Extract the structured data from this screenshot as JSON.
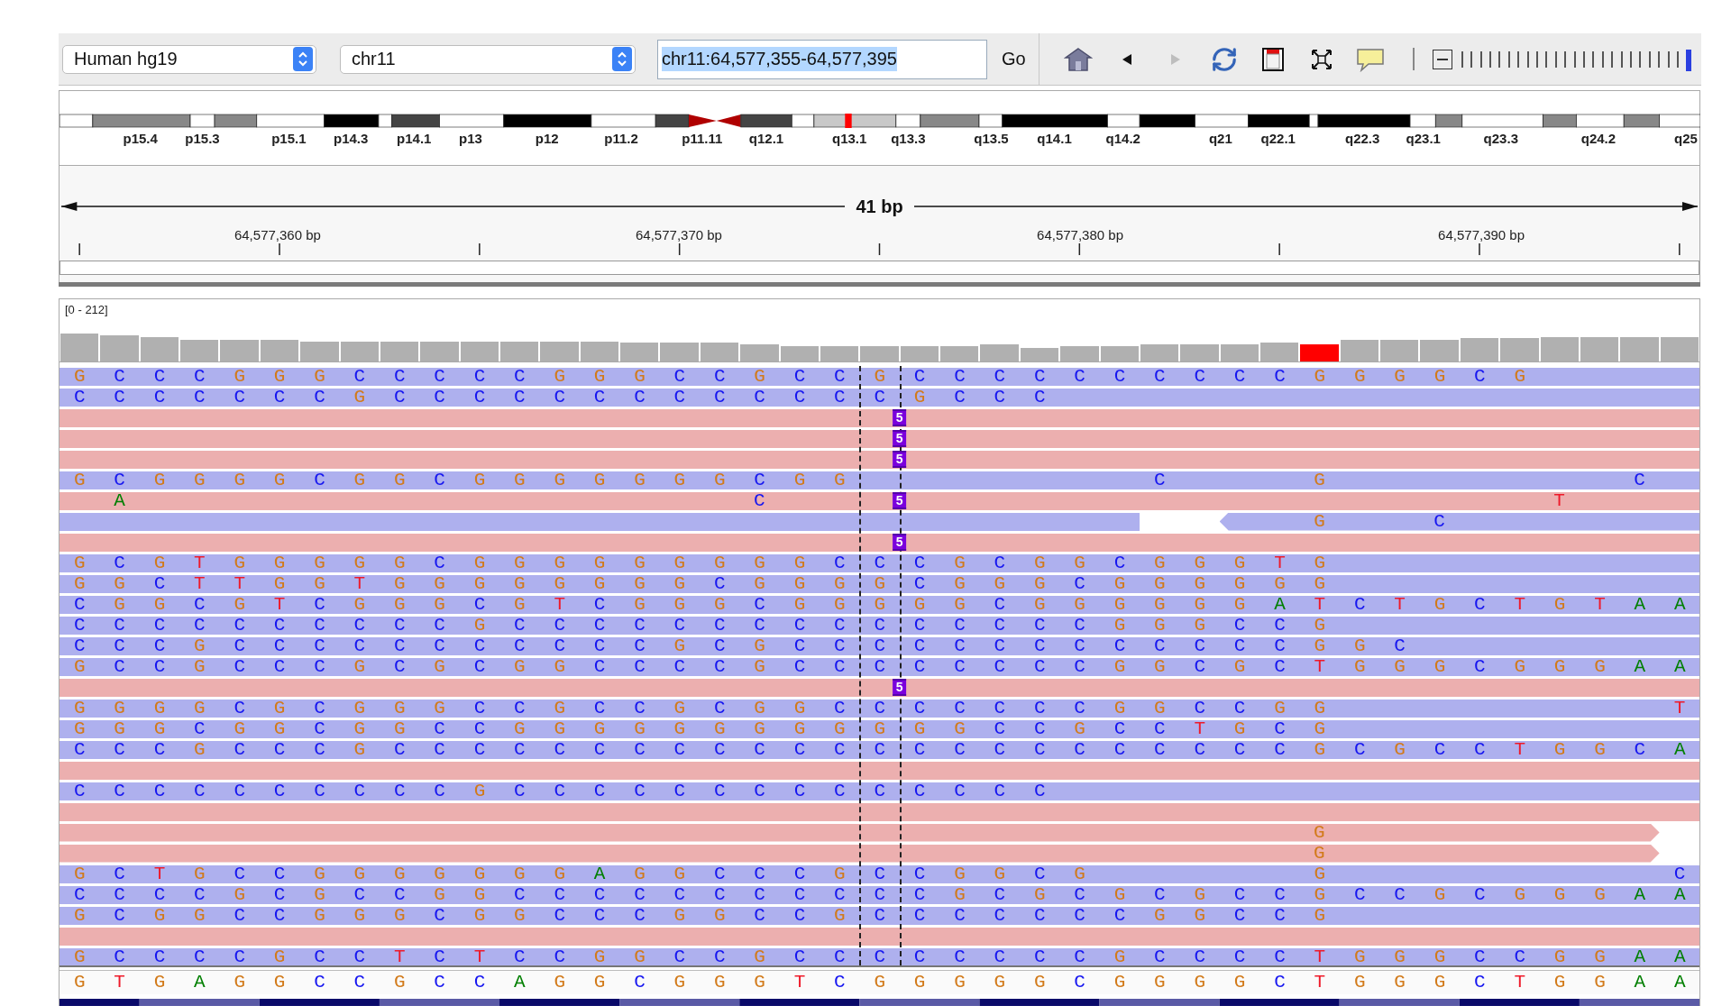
{
  "toolbar": {
    "genome": "Human hg19",
    "chromosome": "chr11",
    "locus": {
      "value": "chr11:64,577,355-64,577,395",
      "selected": true
    },
    "go": "Go",
    "tools": [
      {
        "kind": "home",
        "disabled": false
      },
      {
        "kind": "back",
        "disabled": false
      },
      {
        "kind": "forward",
        "disabled": true
      },
      {
        "kind": "refresh",
        "disabled": false
      },
      {
        "kind": "region",
        "disabled": false
      },
      {
        "kind": "fit",
        "disabled": false
      },
      {
        "kind": "popup",
        "disabled": false
      }
    ],
    "zoom": {
      "level": 1
    }
  },
  "ideogram": {
    "bands": [
      {
        "kind": "gneg"
      },
      {
        "kind": "gpos50"
      },
      {
        "kind": "gneg"
      },
      {
        "kind": "gpos50"
      },
      {
        "kind": "gneg"
      },
      {
        "kind": "gpos100"
      },
      {
        "kind": "gneg"
      },
      {
        "kind": "gpos75"
      },
      {
        "kind": "gneg"
      },
      {
        "kind": "gpos100"
      },
      {
        "kind": "gneg"
      },
      {
        "kind": "gpos75"
      },
      {
        "kind": "acen"
      },
      {
        "kind": "acen"
      },
      {
        "kind": "gpos75"
      },
      {
        "kind": "gneg"
      },
      {
        "kind": "gpos25"
      },
      {
        "kind": "gneg"
      },
      {
        "kind": "gpos50"
      },
      {
        "kind": "gneg"
      },
      {
        "kind": "gpos100"
      },
      {
        "kind": "gneg"
      },
      {
        "kind": "gpos100"
      },
      {
        "kind": "gneg"
      },
      {
        "kind": "gpos100"
      },
      {
        "kind": "gneg"
      },
      {
        "kind": "gpos100"
      },
      {
        "kind": "gneg"
      },
      {
        "kind": "gpos50"
      },
      {
        "kind": "gneg"
      },
      {
        "kind": "gpos50"
      },
      {
        "kind": "gneg"
      },
      {
        "kind": "gpos50"
      },
      {
        "kind": "gneg"
      }
    ],
    "labels": [
      "p15.4",
      "p15.3",
      "p15.1",
      "p14.3",
      "p14.1",
      "p13",
      "p12",
      "p11.2",
      "p11.11",
      "q12.1",
      "q13.1",
      "q13.3",
      "q13.5",
      "q14.1",
      "q14.2",
      "q21",
      "q22.1",
      "q22.3",
      "q23.1",
      "q23.3",
      "q24.2",
      "q25"
    ]
  },
  "ruler": {
    "span": "41 bp",
    "ticks": [
      "64,577,360 bp",
      "64,577,370 bp",
      "64,577,380 bp",
      "64,577,390 bp"
    ]
  },
  "coverage": {
    "range": "[0 - 212]",
    "bars": [
      {
        "mismatch": false
      },
      {
        "mismatch": false
      },
      {
        "mismatch": false
      },
      {
        "mismatch": false
      },
      {
        "mismatch": false
      },
      {
        "mismatch": false
      },
      {
        "mismatch": false
      },
      {
        "mismatch": false
      },
      {
        "mismatch": false
      },
      {
        "mismatch": false
      },
      {
        "mismatch": false
      },
      {
        "mismatch": false
      },
      {
        "mismatch": false
      },
      {
        "mismatch": false
      },
      {
        "mismatch": false
      },
      {
        "mismatch": false
      },
      {
        "mismatch": false
      },
      {
        "mismatch": false
      },
      {
        "mismatch": false
      },
      {
        "mismatch": false
      },
      {
        "mismatch": false
      },
      {
        "mismatch": false
      },
      {
        "mismatch": false
      },
      {
        "mismatch": false
      },
      {
        "mismatch": false
      },
      {
        "mismatch": false
      },
      {
        "mismatch": false
      },
      {
        "mismatch": false
      },
      {
        "mismatch": false
      },
      {
        "mismatch": false
      },
      {
        "mismatch": false
      },
      {
        "mismatch": true
      },
      {
        "mismatch": false
      },
      {
        "mismatch": false
      },
      {
        "mismatch": false
      },
      {
        "mismatch": false
      },
      {
        "mismatch": false
      },
      {
        "mismatch": false
      },
      {
        "mismatch": false
      },
      {
        "mismatch": false
      },
      {
        "mismatch": false
      }
    ]
  },
  "reads": [
    {
      "kind": "reverse",
      "bases": [
        "G C C C G G G C C C C C G G G C C G C C G C C C C C C C C C C G G G G C G"
      ]
    },
    {
      "kind": "reverse",
      "bases": [
        "C C C C C C C G C C C C C C C C C C C C C G C C C"
      ]
    },
    {
      "kind": "forward",
      "insertion": "5"
    },
    {
      "kind": "forward",
      "insertion": "5"
    },
    {
      "kind": "forward",
      "insertion": "5"
    },
    {
      "kind": "reverse",
      "bases": [
        "G C G G G G C G G C G G G G G G G C G G",
        "               C",
        "       G",
        "               C"
      ]
    },
    {
      "kind": "forward",
      "insertion": "5",
      "bases": [
        "  A",
        "                               C",
        "                                       T"
      ]
    },
    {
      "kind": "reverse_split",
      "bases": [
        "                                                              G",
        "     C"
      ]
    },
    {
      "kind": "forward",
      "insertion": "5"
    },
    {
      "kind": "reverse",
      "bases": [
        "G C G T G G G G G C G G G G G G G G G C C C G C G G C G G G T G"
      ]
    },
    {
      "kind": "reverse",
      "bases": [
        "G G C T T G G T G G G G G G G G C G G G G C G G G C G G G G G G"
      ]
    },
    {
      "kind": "reverse",
      "bases": [
        "C G G C G T C G G G C G T C G G G C G G G G G C G G G G G G A T C T G C T G T A A"
      ]
    },
    {
      "kind": "reverse",
      "bases": [
        "C C C C C C C C C C G C C C C C C C C C C C C C C C G G G C C G"
      ]
    },
    {
      "kind": "reverse",
      "bases": [
        "C C C G C C C C C C C C C C C G C G C C C C C C C C C C C C C G G C"
      ]
    },
    {
      "kind": "reverse",
      "bases": [
        "G C C G C C C G C G C G G C C C C G C C C C C C C C G G C G C T G G G C G G G A A"
      ]
    },
    {
      "kind": "forward",
      "insertion": "5"
    },
    {
      "kind": "reverse",
      "bases": [
        "G G G G C G C G G G C C G C C G C G G C C C C C C C G G C C G G",
        "                 T"
      ]
    },
    {
      "kind": "reverse",
      "bases": [
        "G G G C G G C G G C C G G G G G G G G G G G G C C G C C T G C G"
      ]
    },
    {
      "kind": "reverse",
      "bases": [
        "C C C G C C C G C C C C C C C C C C C C C C C C C C C C C C C G C G C C T G G C A"
      ]
    },
    {
      "kind": "forward"
    },
    {
      "kind": "reverse",
      "bases": [
        "C C C C C C C C C C G C C C C C C C C C C C C C C"
      ]
    },
    {
      "kind": "forward"
    },
    {
      "kind": "forward_end",
      "bases": [
        "                                                              G"
      ]
    },
    {
      "kind": "forward_end",
      "bases": [
        "                                                              G"
      ]
    },
    {
      "kind": "reverse",
      "bases": [
        "G C T G C C G G G G G G G A G G C C C G C C G G C G",
        "           G",
        "                 C"
      ]
    },
    {
      "kind": "reverse",
      "bases": [
        "C C C C G C G C C G G C C C C C C C C C C C G C G C G C G C C G C C G C G G G A A"
      ]
    },
    {
      "kind": "reverse",
      "bases": [
        "G C G G C C G G G C G G C C C G G C C G C C C C C C C G G C C G"
      ]
    },
    {
      "kind": "forward"
    },
    {
      "kind": "reverse",
      "bases": [
        "G C C C C G C C T C T C C G G C C G C C C C C C C C G C C C C T G G G C C G G A A"
      ]
    }
  ],
  "reference": "G T G A G G C C G C C A G G C G G G T C G G G G G C G G G G C T G G G C T G G A A"
}
